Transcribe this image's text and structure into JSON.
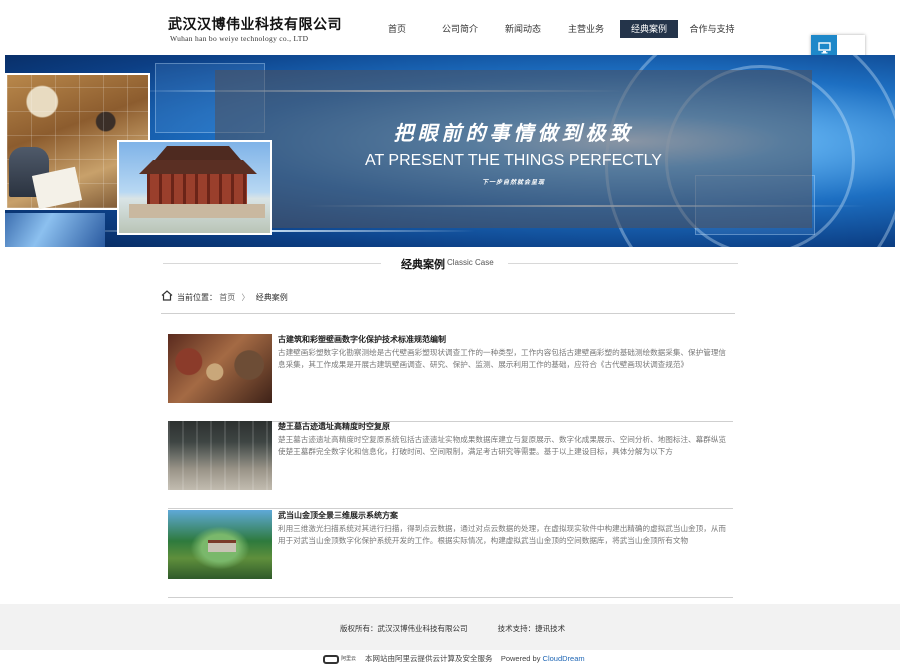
{
  "header": {
    "logo_cn": "武汉汉博伟业科技有限公司",
    "logo_en": "Wuhan han bo weiye technology co., LTD",
    "nav": [
      {
        "label": "首页",
        "active": false
      },
      {
        "label": "公司简介",
        "active": false
      },
      {
        "label": "新闻动态",
        "active": false
      },
      {
        "label": "主营业务",
        "active": false
      },
      {
        "label": "经典案例",
        "active": true
      },
      {
        "label": "合作与支持",
        "active": false
      }
    ]
  },
  "banner": {
    "slogan_cn": "把眼前的事情做到极致",
    "slogan_en": "AT PRESENT THE THINGS PERFECTLY",
    "slogan_sub": "下一步自然就会呈现"
  },
  "section": {
    "title": "经典案例",
    "title_en": "Classic Case"
  },
  "breadcrumb": {
    "prefix": "当前位置：",
    "home": "首页",
    "separator": "〉",
    "current": "经典案例"
  },
  "news": [
    {
      "title": "古建筑和彩塑壁画数字化保护技术标准规范编制",
      "desc": "古建壁画彩塑数字化勘察测绘是古代壁画彩塑现状调查工作的一种类型，工作内容包括古建壁画彩塑的基础测绘数据采集、保护管理信息采集，其工作成果是开展古建筑壁画调查、研究、保护、监测、展示利用工作的基础，应符合《古代壁画现状调查规范》"
    },
    {
      "title": "楚王墓古迹遗址高精度时空复原",
      "desc": "楚王墓古迹遗址高精度时空复原系统包括古迹遗址实物成果数据库建立与复原展示、数字化成果展示、空间分析、地图标注、幕群纵览使楚王墓群完全数字化和信息化，打破时间、空间限制，满足考古研究等需要。基于以上建设目标，具体分解为以下方"
    },
    {
      "title": "武当山金顶全景三维展示系统方案",
      "desc": "利用三维激光扫描系统对其进行扫描，得到点云数据，通过对点云数据的处理，在虚拟现实软件中构建出精确的虚拟武当山金顶，从而用于对武当山金顶数字化保护系统开发的工作。根据实际情况，构建虚拟武当山金顶的空间数据库，将武当山金顶所有文物"
    }
  ],
  "footer": {
    "copyright": "版权所有：武汉汉博伟业科技有限公司",
    "support": "技术支持：捷讯技术",
    "cloud_brand": "阿里云",
    "cloud_text": "本网站由阿里云提供云计算及安全服务",
    "powered_prefix": "Powered by ",
    "powered_brand": "CloudDream"
  },
  "icons": {
    "side_button": "monitor-icon",
    "breadcrumb": "home-icon"
  },
  "colors": {
    "nav_active_bg": "#24344a",
    "side_button": "#1e88c9",
    "footer_bg": "#f2f2f2",
    "powered_brand": "#1e66b5"
  }
}
